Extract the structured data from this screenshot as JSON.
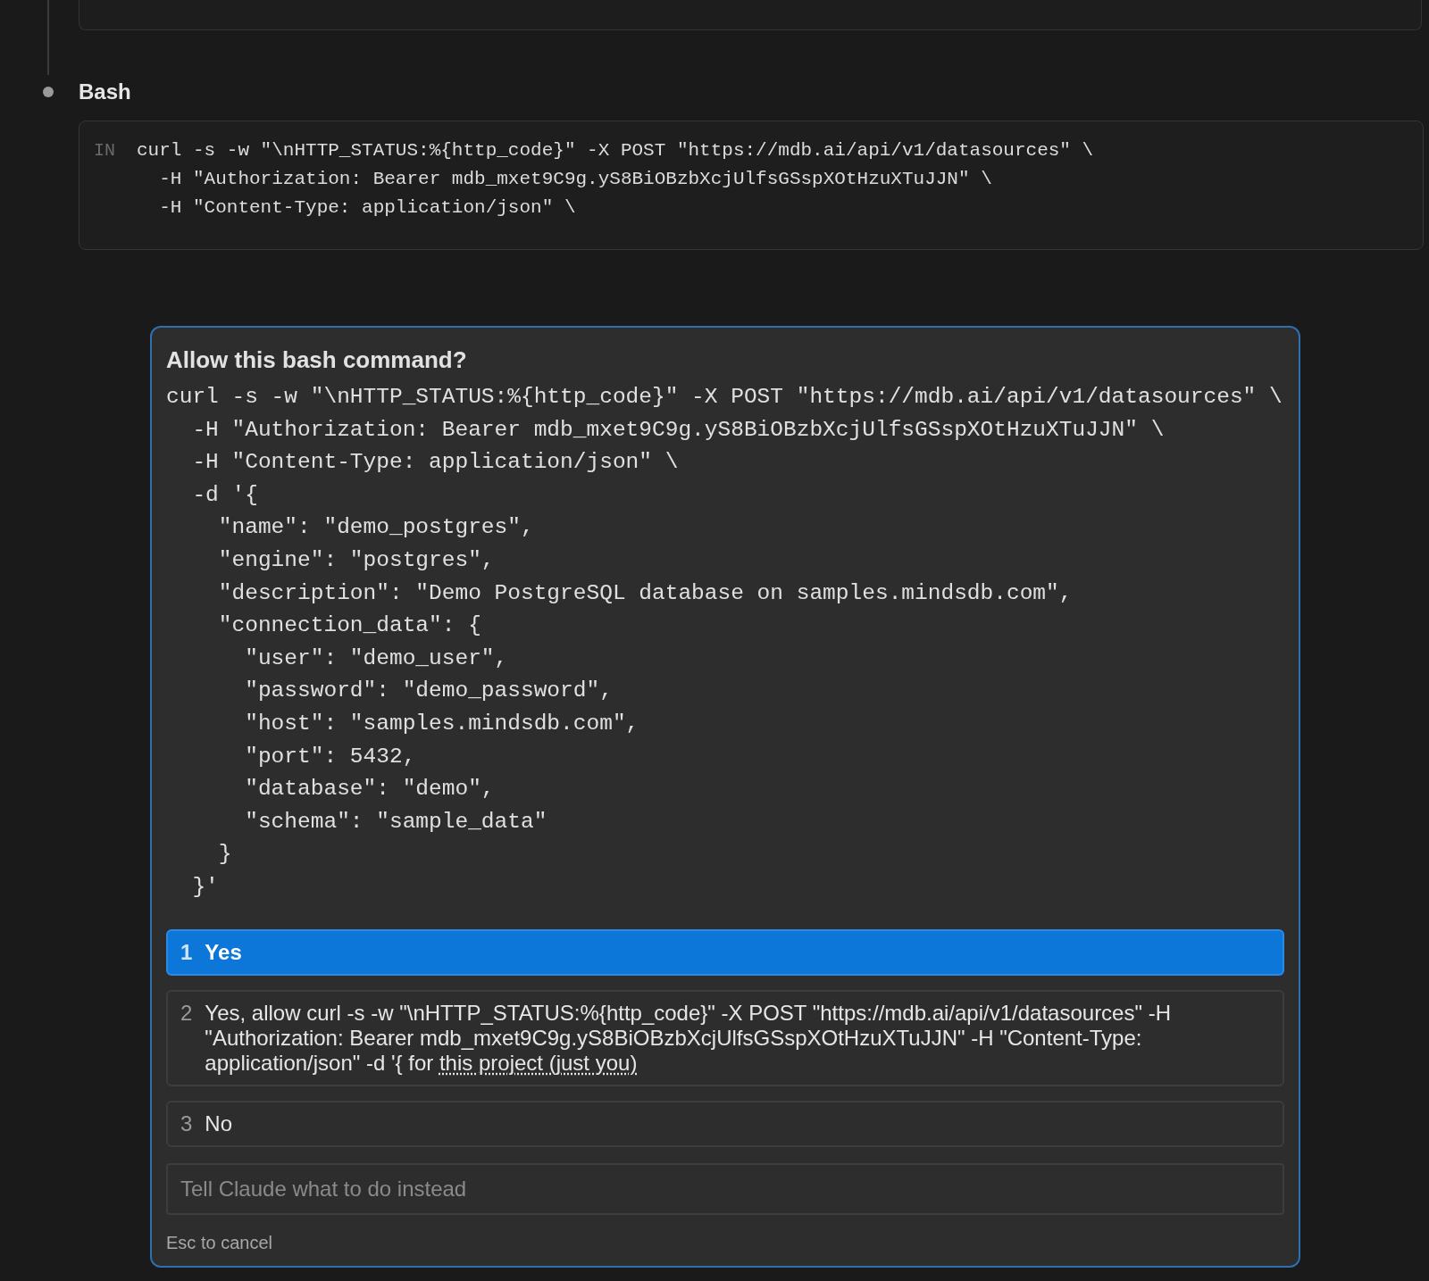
{
  "tool_call": {
    "title": "Bash",
    "input_label": "IN",
    "input_lines": [
      "curl -s -w \"\\nHTTP_STATUS:%{http_code}\" -X POST \"https://mdb.ai/api/v1/datasources\" \\",
      "  -H \"Authorization: Bearer mdb_mxet9C9g.yS8BiOBzbXcjUlfsGSspXOtHzuXTuJJN\" \\",
      "  -H \"Content-Type: application/json\" \\"
    ]
  },
  "dialog": {
    "title": "Allow this bash command?",
    "command_lines": [
      "curl -s -w \"\\nHTTP_STATUS:%{http_code}\" -X POST \"https://mdb.ai/api/v1/datasources\" \\",
      "  -H \"Authorization: Bearer mdb_mxet9C9g.yS8BiOBzbXcjUlfsGSspXOtHzuXTuJJN\" \\",
      "  -H \"Content-Type: application/json\" \\",
      "  -d '{",
      "    \"name\": \"demo_postgres\",",
      "    \"engine\": \"postgres\",",
      "    \"description\": \"Demo PostgreSQL database on samples.mindsdb.com\",",
      "    \"connection_data\": {",
      "      \"user\": \"demo_user\",",
      "      \"password\": \"demo_password\",",
      "      \"host\": \"samples.mindsdb.com\",",
      "      \"port\": 5432,",
      "      \"database\": \"demo\",",
      "      \"schema\": \"sample_data\"",
      "    }",
      "  }'"
    ],
    "options": [
      {
        "number": "1",
        "label": "Yes",
        "selected": true
      },
      {
        "number": "2",
        "label": "Yes, allow curl -s -w \"\\nHTTP_STATUS:%{http_code}\" -X POST \"https://mdb.ai/api/v1/datasources\" -H \"Authorization: Bearer mdb_mxet9C9g.yS8BiOBzbXcjUlfsGSspXOtHzuXTuJJN\" -H \"Content-Type: application/json\" -d '{ for ",
        "link": "this project (just you)",
        "selected": false
      },
      {
        "number": "3",
        "label": "No",
        "selected": false
      }
    ],
    "feedback": {
      "placeholder": "Tell Claude what to do instead"
    },
    "hint": "Esc to cancel"
  }
}
